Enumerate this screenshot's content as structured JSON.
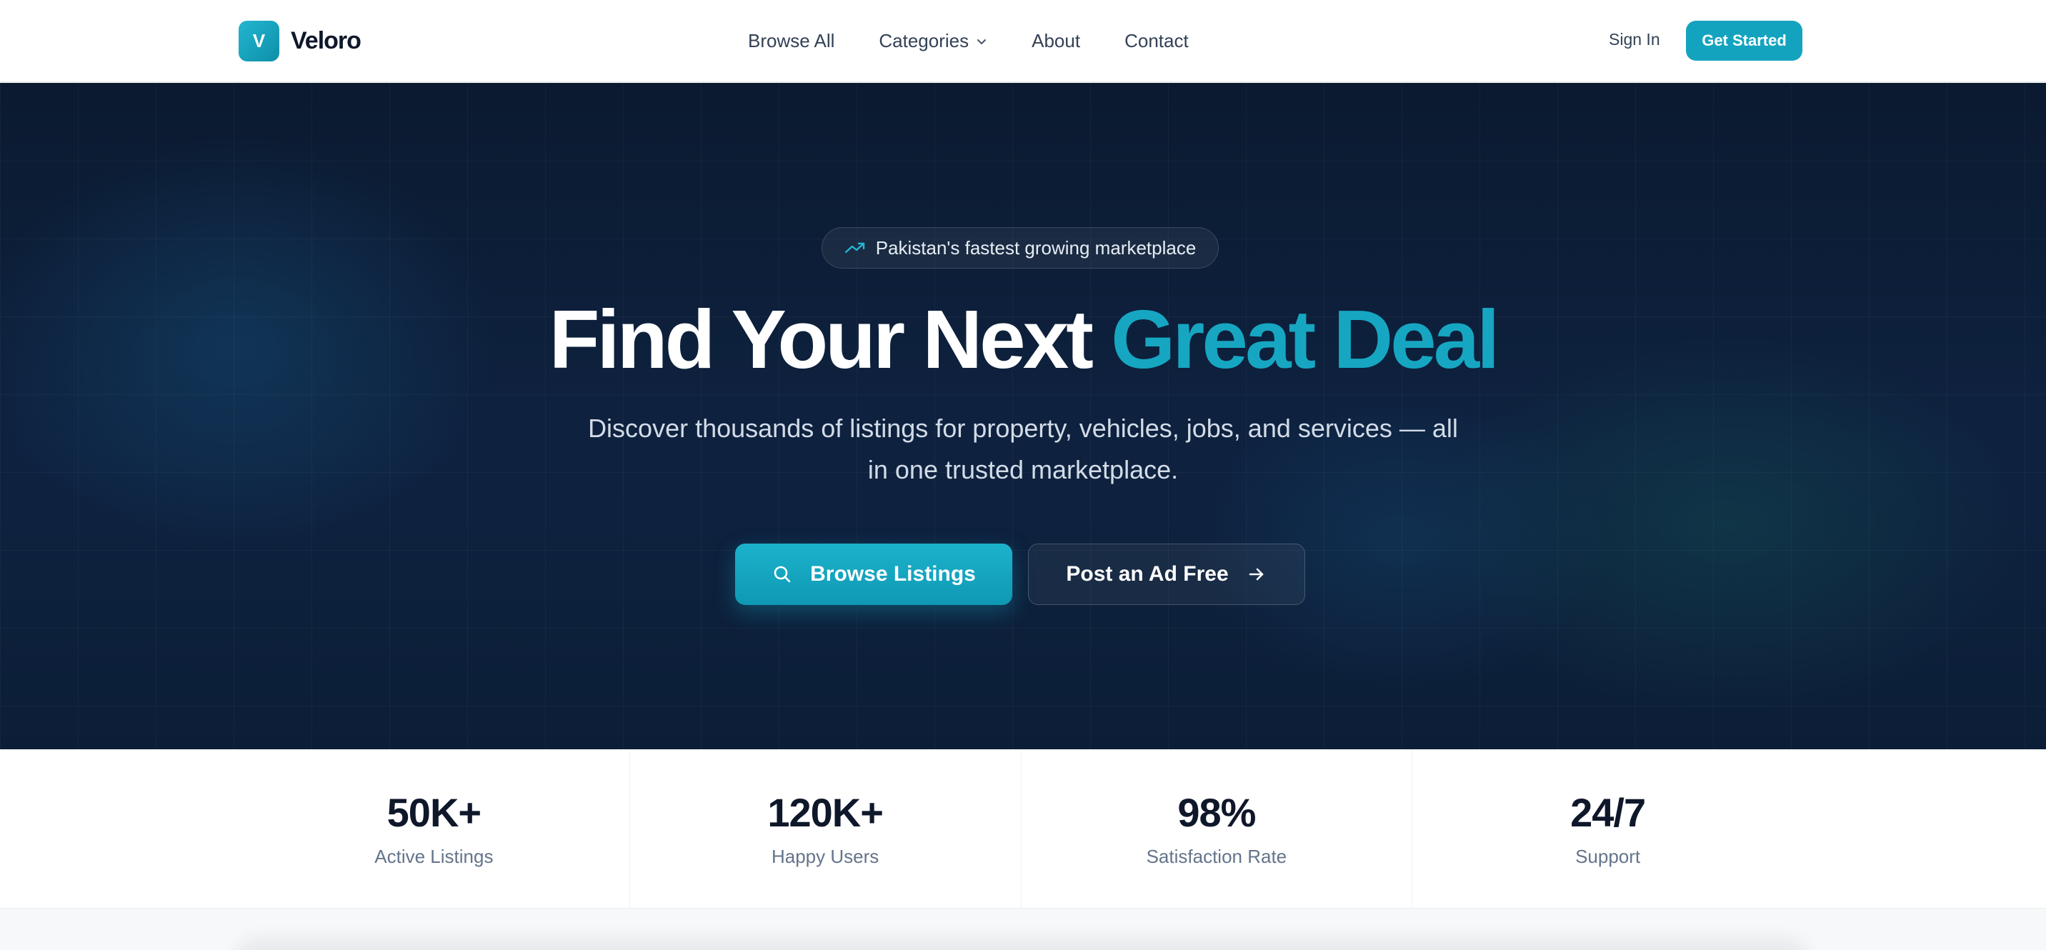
{
  "nav": {
    "brand_initial": "V",
    "brand_name": "Veloro",
    "links": [
      {
        "label": "Browse All"
      },
      {
        "label": "Categories"
      },
      {
        "label": "About"
      },
      {
        "label": "Contact"
      }
    ],
    "sign_in": "Sign In",
    "get_started": "Get Started"
  },
  "hero": {
    "badge": "Pakistan's fastest growing marketplace",
    "headline_main": "Find Your Next ",
    "headline_accent": "Great Deal",
    "subtitle": "Discover thousands of listings for property, vehicles, jobs, and services — all in one trusted marketplace.",
    "primary_button": "Browse Listings",
    "secondary_button": "Post an Ad Free"
  },
  "stats": [
    {
      "value": "50K+",
      "label": "Active Listings"
    },
    {
      "value": "120K+",
      "label": "Happy Users"
    },
    {
      "value": "98%",
      "label": "Satisfaction Rate"
    },
    {
      "value": "24/7",
      "label": "Support"
    }
  ],
  "colors": {
    "accent": "#16a6c2",
    "hero_bg": "#0d2039",
    "text_dark": "#0f172a",
    "text_muted": "#64748b"
  },
  "icons": {
    "trend": "trending-up-icon",
    "search": "search-icon",
    "arrow": "arrow-right-icon",
    "chevron": "chevron-down-icon"
  }
}
